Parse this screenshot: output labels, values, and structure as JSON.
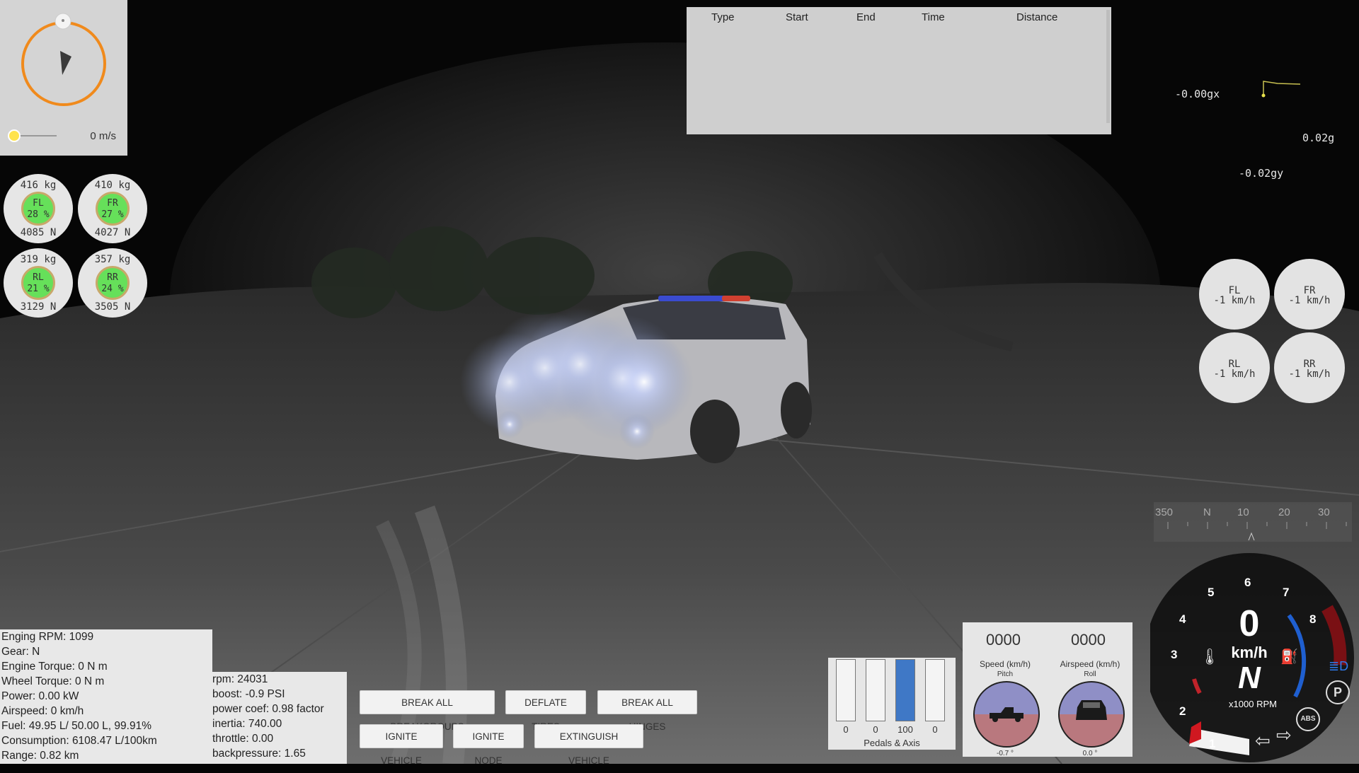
{
  "top_left": {
    "speed": "0 m/s"
  },
  "tire_loads": [
    {
      "id": "FL",
      "kg": "416  kg",
      "pct": "28 %",
      "n": "4085  N"
    },
    {
      "id": "FR",
      "kg": "410  kg",
      "pct": "27 %",
      "n": "4027  N"
    },
    {
      "id": "RL",
      "kg": "319  kg",
      "pct": "21 %",
      "n": "3129  N"
    },
    {
      "id": "RR",
      "kg": "357  kg",
      "pct": "24 %",
      "n": "3505  N"
    }
  ],
  "lap_table": {
    "headers": [
      "Type",
      "Start",
      "End",
      "Time",
      "Distance"
    ]
  },
  "g_meter": {
    "gx": "-0.00gx",
    "g": "0.02g",
    "gy": "-0.02gy"
  },
  "wheel_speeds": [
    {
      "id": "FL",
      "value": "-1 km/h"
    },
    {
      "id": "FR",
      "value": "-1 km/h"
    },
    {
      "id": "RL",
      "value": "-1 km/h"
    },
    {
      "id": "RR",
      "value": "-1 km/h"
    }
  ],
  "compass": {
    "labels": [
      "350",
      "N",
      "10",
      "20",
      "30"
    ]
  },
  "engine_info": [
    "Enging RPM: 1099",
    "Gear: N",
    "Engine Torque: 0 N m",
    "Wheel Torque: 0 N m",
    "Power: 0.00 kW",
    "Airspeed: 0 km/h",
    "Fuel: 49.95 L/ 50.00 L, 99.91%",
    "Consumption: 6108.47 L/100km",
    "Range: 0.82 km"
  ],
  "turbo_info": [
    "rpm: 24031",
    "boost: -0.9 PSI",
    "power coef: 0.98 factor",
    "inertia: 740.00",
    "throttle: 0.00",
    "backpressure: 1.65"
  ],
  "buttons": {
    "break_breakgroups": "BREAK ALL BREAKGROUPS",
    "deflate_tires": "DEFLATE TIRES",
    "break_hinges": "BREAK ALL HINGES",
    "ignite_vehicle": "IGNITE VEHICLE",
    "ignite_node": "IGNITE NODE",
    "extinguish_vehicle": "EXTINGUISH VEHICLE"
  },
  "pedals": {
    "title": "Pedals & Axis",
    "values": [
      "0",
      "0",
      "100",
      "0"
    ],
    "levels": [
      0,
      0,
      1.0,
      0
    ],
    "fill_color": "#3f78c6"
  },
  "attitude": {
    "speed_value": "0000",
    "speed_label": "Speed (km/h)",
    "pitch_label": "Pitch",
    "pitch_value": "-0.7 °",
    "airspeed_value": "0000",
    "airspeed_label": "Airspeed (km/h)",
    "roll_label": "Roll",
    "roll_value": "0.0 °",
    "sky_color": "#8f8fc6",
    "ground_color": "#b9787e"
  },
  "dashboard": {
    "gear": "N",
    "speed_digit": "0",
    "speed_unit": "km/h",
    "rpm_unit": "x1000 RPM",
    "rpm_ticks": [
      "1",
      "2",
      "3",
      "4",
      "5",
      "6",
      "7",
      "8"
    ],
    "abs_label": "ABS",
    "parking_label": "P",
    "accent_blue": "#1f5fd0",
    "accent_red": "#c0232a"
  }
}
